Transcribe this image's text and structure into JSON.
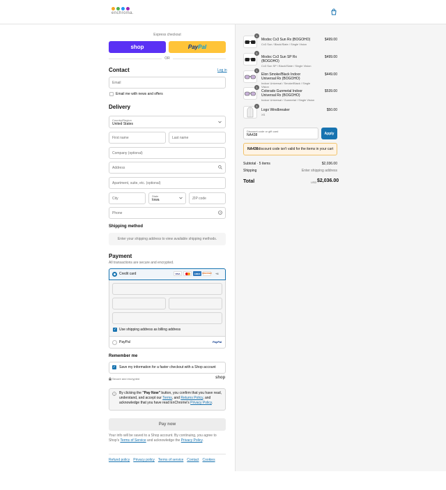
{
  "brand": {
    "logo_text": "enchroma.",
    "dot_colors": [
      "#f5a623",
      "#4caf50",
      "#2196f3",
      "#9c27b0"
    ]
  },
  "express": {
    "label": "Express checkout",
    "shop_label": "shop",
    "paypal_label_a": "Pay",
    "paypal_label_b": "Pal",
    "or_label": "OR"
  },
  "contact": {
    "title": "Contact",
    "login": "Log in",
    "email_placeholder": "Email",
    "newsletter_label": "Email me with news and offers"
  },
  "delivery": {
    "title": "Delivery",
    "country_label": "Country/Region",
    "country_value": "United States",
    "first_name": "First name",
    "last_name": "Last name",
    "company": "Company (optional)",
    "address": "Address",
    "apartment": "Apartment, suite, etc. (optional)",
    "city": "City",
    "state_label": "State",
    "state_value": "Iowa",
    "zip": "ZIP code",
    "phone": "Phone"
  },
  "shipping_method": {
    "title": "Shipping method",
    "message": "Enter your shipping address to view available shipping methods."
  },
  "payment": {
    "title": "Payment",
    "subtitle": "All transactions are secure and encrypted.",
    "credit_card": "Credit card",
    "card_brands": [
      "VISA",
      "MC",
      "AMEX",
      "DISCOVER"
    ],
    "more": "+4",
    "billing_label": "Use shipping address as billing address",
    "paypal": "PayPal"
  },
  "remember": {
    "title": "Remember me",
    "save_label": "Save my information for a faster checkout with a Shop account",
    "secure": "Secure and encrypted",
    "shop_word": "shop"
  },
  "notice": {
    "text_a": "By clicking the ",
    "pay_now_bold": "\"Pay Now\"",
    "text_b": " button, you confirm that you have read, understand, and accept our ",
    "terms": "Terms",
    "text_c": ", and ",
    "returns": "Returns Policy",
    "text_d": ", and acknowledge that you have read EnChrome's ",
    "privacy": "Privacy Policy",
    "text_e": "."
  },
  "pay_now": "Pay now",
  "shop_notice": {
    "text_a": "Your info will be saved to a Shop account. By continuing, you agree to Shop's ",
    "tos": "Terms of Service",
    "text_b": " and acknowledge the ",
    "privacy": "Privacy Policy",
    "text_c": "."
  },
  "footer_links": [
    "Refund policy",
    "Privacy policy",
    "Terms of service",
    "Contact",
    "Cookies"
  ],
  "cart": {
    "items": [
      {
        "qty": "1",
        "name": "Modoc Cx3 Sun Rx (BOGOHO)",
        "variant": "Cx3 Sun / Black/Slate / Single Vision",
        "price": "$499.00",
        "kind": "sun"
      },
      {
        "qty": "1",
        "name": "Modoc Cx3 Sun SP Rx (BOGOHO)",
        "variant": "Cx3 Sun SP / Black/Slate / Single Vision",
        "price": "$499.00",
        "kind": "sun"
      },
      {
        "qty": "1",
        "name": "Elon Smoke/Black Indoor Universal Rx (BOGOHO)",
        "variant": "Indoor Universal / Smoke/Black / Single Vision",
        "price": "$449.00",
        "kind": "indoor"
      },
      {
        "qty": "1",
        "name": "Colorado Gunmetal Indoor Universal Rx (BOGOHO)",
        "variant": "Indoor Universal / Gunmetal / Single Vision",
        "price": "$539.00",
        "kind": "indoor"
      },
      {
        "qty": "1",
        "name": "Logo Windbreaker",
        "variant": "XS",
        "price": "$50.00",
        "kind": "jacket"
      }
    ],
    "discount_label": "Discount code or gift card",
    "discount_value": "NA438",
    "apply": "Apply",
    "error_code": "NA438",
    "error_text": " discount code isn't valid for the items in your cart",
    "subtotal_label": "Subtotal · 5 items",
    "subtotal_value": "$2,036.00",
    "shipping_label": "Shipping",
    "shipping_value": "Enter shipping address",
    "total_label": "Total",
    "currency": "USD",
    "total_value": "$2,036.00"
  }
}
